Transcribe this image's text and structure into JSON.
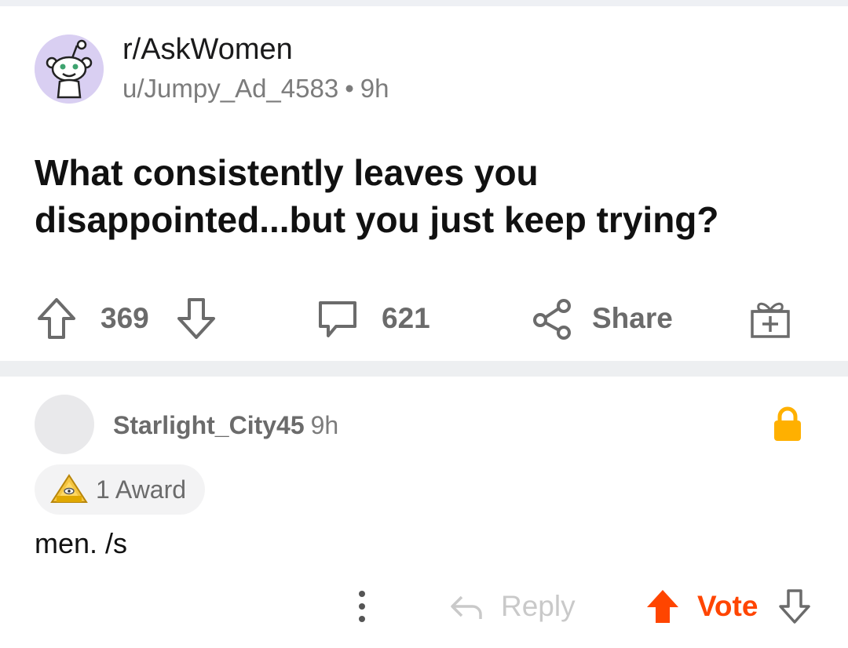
{
  "post": {
    "subreddit": "r/AskWomen",
    "author": "u/Jumpy_Ad_4583",
    "separator": "•",
    "age": "9h",
    "title_line1": "What consistently leaves you",
    "title_line2": "disappointed...but you just keep trying?",
    "upvotes": "369",
    "comments": "621",
    "share_label": "Share",
    "icons": {
      "avatar": "reddit-snoo-avatar-icon",
      "upvote": "arrow-up-outline-icon",
      "downvote": "arrow-down-outline-icon",
      "comment": "speech-bubble-icon",
      "share": "share-nodes-icon",
      "award": "gift-box-plus-icon"
    }
  },
  "comment": {
    "author": "Starlight_City45",
    "age": "9h",
    "award_label": "1 Award",
    "body": "men. /s",
    "reply_label": "Reply",
    "vote_label": "Vote",
    "icons": {
      "lock": "lock-icon",
      "award": "gold-award-icon",
      "more": "more-vertical-icon",
      "reply": "reply-arrow-icon",
      "upvote": "arrow-up-filled-icon",
      "downvote": "arrow-down-outline-icon"
    }
  },
  "colors": {
    "accent_orange": "#ff4500",
    "lock_yellow": "#ffb000",
    "muted_gray": "#6b6b6b",
    "avatar_lavender": "#d9cff2"
  }
}
